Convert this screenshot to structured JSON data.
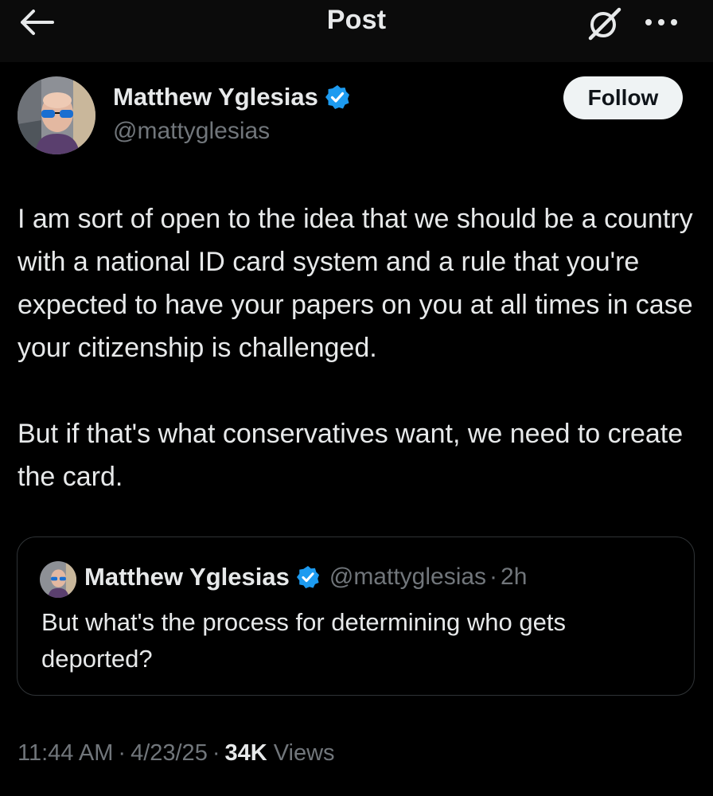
{
  "header": {
    "title": "Post",
    "back_icon": "arrow-left-icon",
    "grok_icon": "grok-icon",
    "more_icon": "more-horizontal-icon"
  },
  "author": {
    "display_name": "Matthew Yglesias",
    "handle": "@mattyglesias",
    "verified": true,
    "follow_label": "Follow"
  },
  "tweet": {
    "paragraphs": [
      "I am sort of open to the idea that we should be a country with a national ID card system and a rule that you're expected to have your papers on you at all times in case your citizenship is challenged.",
      "But if that's what conservatives want, we need to create the card."
    ]
  },
  "quoted": {
    "display_name": "Matthew Yglesias",
    "handle": "@mattyglesias",
    "separator": "·",
    "time": "2h",
    "text": "But what's the process for determining who gets deported?"
  },
  "meta": {
    "time": "11:44 AM",
    "date": "4/23/25",
    "separator": "·",
    "views_count": "34K",
    "views_label": "Views"
  },
  "colors": {
    "background": "#000000",
    "text": "#e7e9ea",
    "secondary": "#71767b",
    "verified_blue": "#1d9bf0",
    "border": "#2f3336"
  }
}
